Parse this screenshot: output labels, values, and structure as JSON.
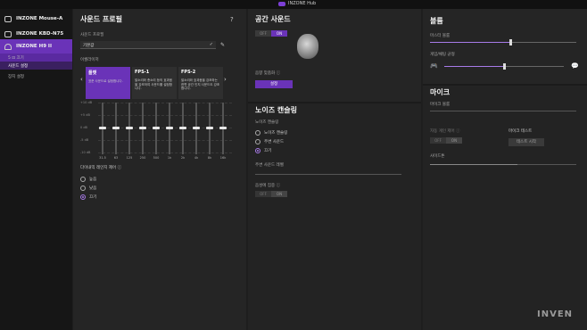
{
  "titlebar": {
    "title": "INZONE Hub"
  },
  "sidebar": {
    "devices": [
      {
        "name": "INZONE Mouse-A"
      },
      {
        "name": "INZONE KBD-N75"
      },
      {
        "name": "INZONE H9 II"
      }
    ],
    "subitems": [
      "5 ⊡ 끄기",
      "사운드 설정",
      "장치 설정"
    ]
  },
  "sound_profile": {
    "title": "사운드 프로필",
    "profile_label": "사운드 프로필",
    "profile_value": "기본값",
    "eq_label": "이퀄라이저",
    "presets": [
      {
        "name": "플랫",
        "desc": "표준 사운드로 설정합니다."
      },
      {
        "name": "FPS-1",
        "desc": "발소리와 총소리 등의 효과음을 강조하여 사운드를 설정합니다."
      },
      {
        "name": "FPS-2",
        "desc": "발소리와 효과음을 강조하는 한편 공간 인지 사운드도 강조합니다."
      }
    ],
    "eq_ylabels": [
      "+10 dB",
      "+5 dB",
      "0 dB",
      "-5 dB",
      "-10 dB"
    ],
    "eq_bands": [
      "31.5",
      "63",
      "125",
      "250",
      "500",
      "1k",
      "2k",
      "4k",
      "8k",
      "16k"
    ],
    "drc_label": "다이내믹 레인지 제어",
    "drc_options": [
      "높음",
      "낮음",
      "끄기"
    ],
    "drc_selected": "끄기"
  },
  "spatial": {
    "title": "공간 사운드",
    "toggle": {
      "off": "OFF",
      "on": "ON"
    },
    "optimize_label": "음향 맞춤화",
    "setup_button": "설정"
  },
  "noise": {
    "title": "노이즈 캔슬링",
    "nc_label": "노이즈 캔슬링",
    "options": [
      "노이즈 캔슬링",
      "주변 사운드",
      "끄기"
    ],
    "selected": "끄기",
    "ambient_label": "주변 사운드 레벨",
    "focus_label": "음성에 집중",
    "focus_toggle": {
      "off": "OFF",
      "on": "ON"
    }
  },
  "volume": {
    "title": "볼륨",
    "master_label": "마스터 볼륨",
    "master_level": 0.55,
    "balance_label": "게임/채팅 균형",
    "balance_level": 0.5
  },
  "mic": {
    "title": "마이크",
    "mic_volume_label": "마이크 볼륨",
    "agc_label": "자동 게인 제어",
    "agc_toggle": {
      "off": "OFF",
      "on": "ON"
    },
    "test_label": "마이크 테스트",
    "test_button": "테스트 시작",
    "sidetone_label": "사이드톤",
    "sidetone_level": 0.6
  },
  "watermark": "INVEN"
}
